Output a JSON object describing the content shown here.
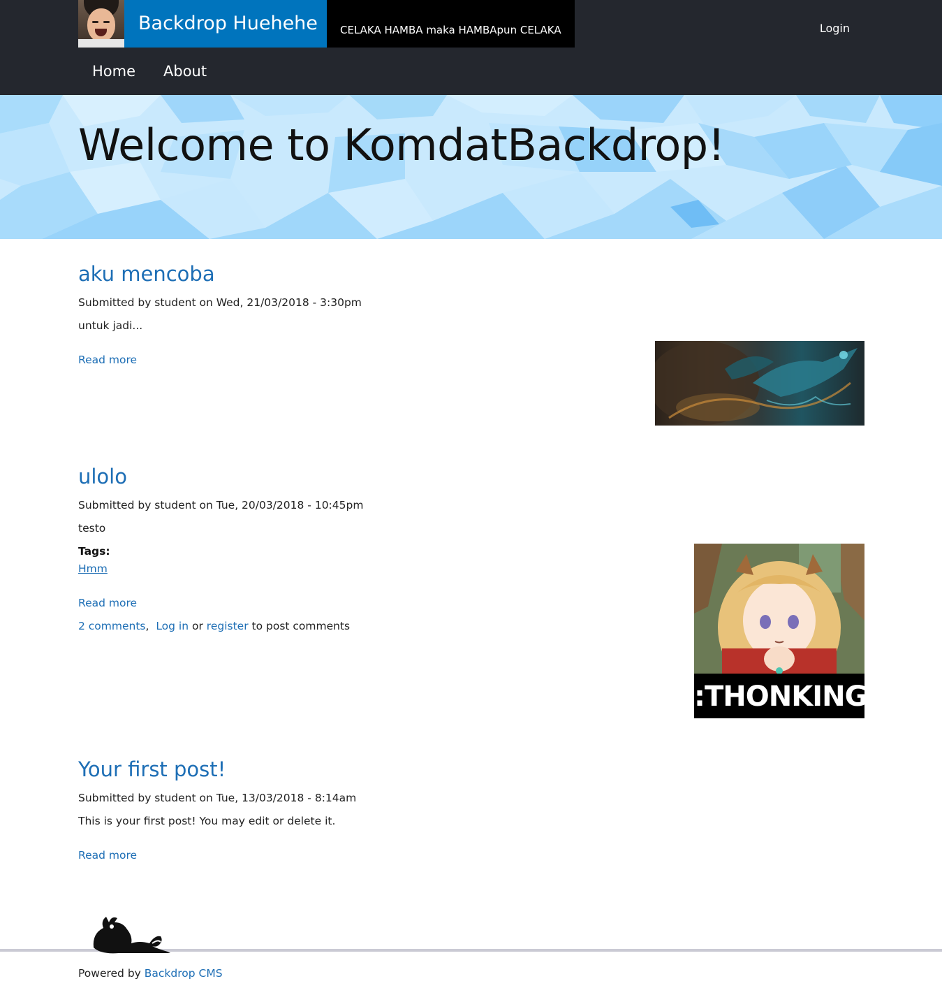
{
  "header": {
    "site_name": "Backdrop Huehehe",
    "slogan": "CELAKA HAMBA maka HAMBApun CELAKA",
    "login_label": "Login",
    "menu": [
      {
        "label": "Home"
      },
      {
        "label": "About"
      }
    ]
  },
  "hero": {
    "title": "Welcome to KomdatBackdrop!"
  },
  "posts": [
    {
      "title": "aku mencoba",
      "meta": "Submitted by student on Wed, 21/03/2018 - 3:30pm",
      "body": "untuk jadi...",
      "read_more": "Read more"
    },
    {
      "title": "ulolo",
      "meta": "Submitted by student on Tue, 20/03/2018 - 10:45pm",
      "body": "testo",
      "tags_label": "Tags:",
      "tags": [
        "Hmm"
      ],
      "read_more": "Read more",
      "comments_link": "2 comments",
      "comments_sep": ",",
      "login_link": "Log in",
      "or_text": "or",
      "register_link": "register",
      "post_comments_text": "to post comments",
      "image_caption": ":THONKING:"
    },
    {
      "title": "Your first post!",
      "meta": "Submitted by student on Tue, 13/03/2018 - 8:14am",
      "body": "This is your first post! You may edit or delete it.",
      "read_more": "Read more"
    }
  ],
  "footer": {
    "powered_by": "Powered by",
    "cms_link": "Backdrop CMS"
  },
  "colors": {
    "header_bg": "#24272e",
    "site_name_bg": "#0074bd",
    "link": "#1d6eb5",
    "hero_bg": "#c9e9fd"
  },
  "icons": {
    "site_logo": "avatar-photo",
    "footer_logo": "backdrop-dragon-logo"
  }
}
